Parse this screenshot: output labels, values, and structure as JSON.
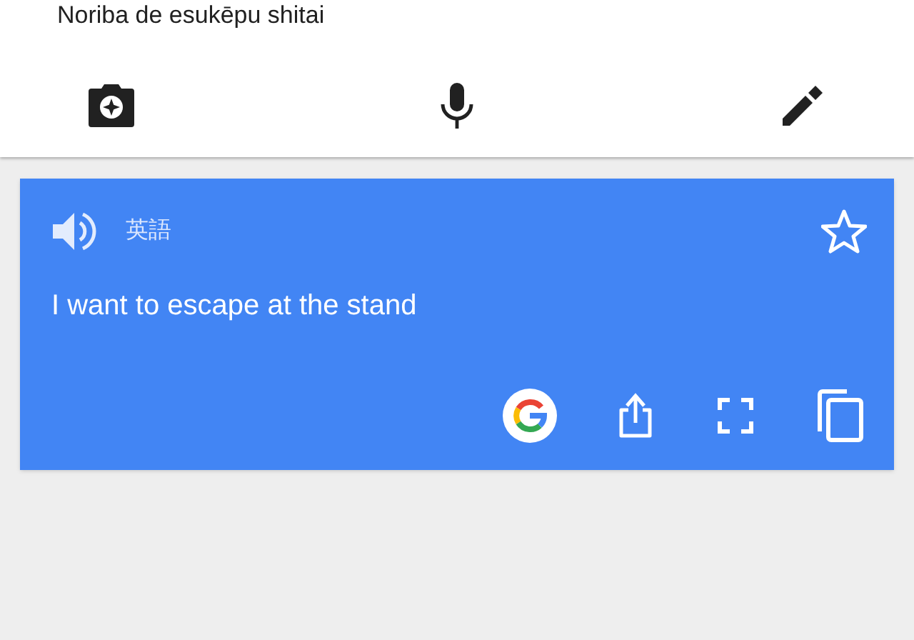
{
  "source": {
    "romanization": "Noriba de esukēpu shitai"
  },
  "result": {
    "language": "英語",
    "text": "I want to escape at the stand",
    "starred": false
  }
}
